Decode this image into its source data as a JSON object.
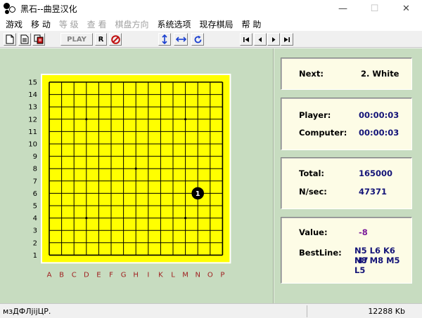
{
  "window": {
    "title": "黑石--曲昱汉化",
    "minimize_glyph": "—",
    "maximize_glyph": "☐",
    "close_glyph": "✕"
  },
  "menu": [
    {
      "label": "游戏",
      "enabled": true
    },
    {
      "label": "移 动",
      "enabled": true
    },
    {
      "label": "等 级",
      "enabled": false
    },
    {
      "label": "查 看",
      "enabled": false
    },
    {
      "label": "棋盘方向",
      "enabled": false
    },
    {
      "label": "系统选项",
      "enabled": true
    },
    {
      "label": "现存棋局",
      "enabled": true
    },
    {
      "label": "帮 助",
      "enabled": true
    }
  ],
  "toolbar": {
    "play_label": "PLAY",
    "r_label": "R",
    "icon_color_blue": "#1a3fd0",
    "icon_color_red": "#c01010"
  },
  "board": {
    "size": 15,
    "columns": [
      "A",
      "B",
      "C",
      "D",
      "E",
      "F",
      "G",
      "H",
      "I",
      "K",
      "L",
      "M",
      "N",
      "O",
      "P"
    ],
    "rows": [
      "15",
      "14",
      "13",
      "12",
      "11",
      "10",
      "9",
      "8",
      "7",
      "6",
      "5",
      "4",
      "3",
      "2",
      "1"
    ],
    "star_points": [
      "D12",
      "M12",
      "H8",
      "D4",
      "M4"
    ],
    "stones": [
      {
        "point": "N6",
        "color": "black",
        "number": "1"
      }
    ],
    "board_color": "#ffff00",
    "column_label_color": "#a02020"
  },
  "info": {
    "next_label": "Next:",
    "next_value": "2. White",
    "player_label": "Player:",
    "player_time": "00:00:03",
    "computer_label": "Computer:",
    "computer_time": "00:00:03",
    "total_label": "Total:",
    "total_value": "165000",
    "nsec_label": "N/sec:",
    "nsec_value": "47371",
    "value_label": "Value:",
    "value_value": "-8",
    "value_color": "#7a1a9a",
    "bestline_label": "BestLine:",
    "bestline_lines": [
      "N5 L6 K6 M7",
      "N8 M8 M5",
      "L5"
    ]
  },
  "status": {
    "left_text": "мзДФЛjijЦР.",
    "right_text": "12288 Kb"
  }
}
